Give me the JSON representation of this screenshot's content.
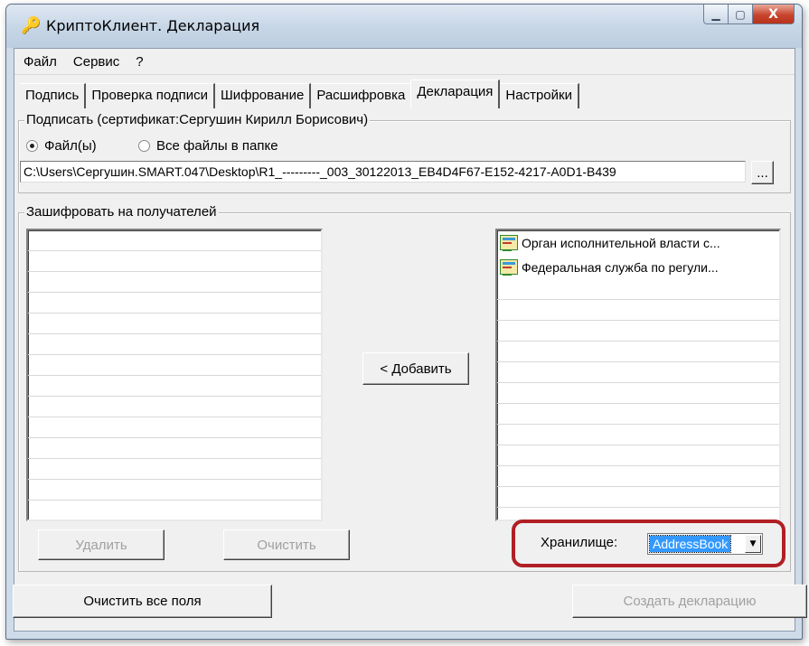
{
  "window": {
    "title": "КриптоКлиент. Декларация",
    "close_glyph": "X",
    "min_glyph": "▁",
    "max_glyph": "▢"
  },
  "menu": [
    "Файл",
    "Сервис",
    "?"
  ],
  "tabs": [
    {
      "label": "Подпись",
      "active": false
    },
    {
      "label": "Проверка подписи",
      "active": false
    },
    {
      "label": "Шифрование",
      "active": false
    },
    {
      "label": "Расшифровка",
      "active": false
    },
    {
      "label": "Декларация",
      "active": true
    },
    {
      "label": "Настройки",
      "active": false
    }
  ],
  "sign_group": {
    "legend": "Подписать (сертификат:Сергушин Кирилл Борисович)",
    "radio_files": "Файл(ы)",
    "radio_folder": "Все файлы в папке",
    "selected": "files",
    "path_value": "C:\\Users\\Сергушин.SMART.047\\Desktop\\R1_---------_003_30122013_EB4D4F67-E152-4217-A0D1-B439",
    "browse_label": "..."
  },
  "encrypt_group": {
    "legend": "Зашифровать на получателей",
    "add_button": "< Добавить",
    "delete_button": "Удалить",
    "clear_button": "Очистить",
    "recipients_available": [
      "Орган исполнительной власти с...",
      "Федеральная служба по регули..."
    ],
    "storage_label": "Хранилище:",
    "storage_value": "AddressBook",
    "dropdown_glyph": "▼"
  },
  "footer": {
    "clear_all_button": "Очистить все поля",
    "create_button": "Создать декларацию"
  },
  "colors": {
    "highlight_border": "#b01f24",
    "selection": "#3399ff"
  }
}
